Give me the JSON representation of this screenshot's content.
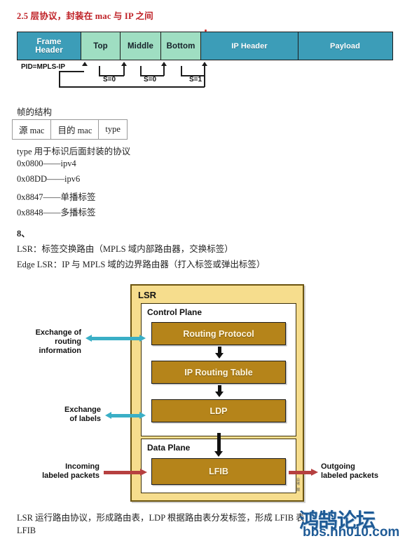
{
  "heading": "2.5 层协议，封装在 mac 与 IP 之间",
  "mpls_frame": {
    "fields": [
      {
        "label": "Frame\nHeader",
        "color": "#3c9db8",
        "kind": "blue"
      },
      {
        "label": "Top",
        "color": "#9fdec2",
        "kind": "green"
      },
      {
        "label": "Middle",
        "color": "#9fdec2",
        "kind": "green"
      },
      {
        "label": "Bottom",
        "color": "#9fdec2",
        "kind": "green"
      },
      {
        "label": "IP Header",
        "color": "#3c9db8",
        "kind": "blue"
      },
      {
        "label": "Payload",
        "color": "#3c9db8",
        "kind": "blue"
      }
    ],
    "field_labels": {
      "frame_header_line1": "Frame",
      "frame_header_line2": "Header",
      "top": "Top",
      "middle": "Middle",
      "bottom": "Bottom",
      "ip_header": "IP Header",
      "payload": "Payload"
    },
    "annotations": {
      "pid": "PID=MPLS-IP",
      "s0_a": "S=0",
      "s0_b": "S=0",
      "s1": "S=1"
    }
  },
  "section_frame_structure": {
    "caption": "帧的结构",
    "table": {
      "headers": [
        "源 mac",
        "目的 mac",
        "type"
      ]
    },
    "type_note": "type 用于标识后面封装的协议",
    "type_values": [
      "0x0800——ipv4",
      "0x08DD——ipv6",
      "0x8847——单播标签",
      "0x8848——多播标签"
    ]
  },
  "section_eight": {
    "number": "8、",
    "lsr_line": "LSR：标签交换路由（MPLS 域内部路由器，交换标签）",
    "edge_lsr_line": "Edge LSR：IP 与 MPLS 域的边界路由器（打入标签或弹出标签）"
  },
  "lsr_diagram": {
    "title": "LSR",
    "control_plane": {
      "title": "Control Plane",
      "boxes": [
        "Routing Protocol",
        "IP Routing Table",
        "LDP"
      ]
    },
    "data_plane": {
      "title": "Data Plane",
      "boxes": [
        "LFIB"
      ]
    },
    "left_labels": [
      {
        "line1": "Exchange of",
        "line2": "routing information"
      },
      {
        "line1": "Exchange",
        "line2": "of labels"
      },
      {
        "line1": "Incoming",
        "line2": "labeled packets"
      }
    ],
    "right_labels": [
      {
        "line1": "Outgoing",
        "line2": "labeled packets"
      }
    ],
    "side_note": "自拷_图",
    "colors": {
      "frame_yellow": "#f6dd8d",
      "box_gold": "#b5841a",
      "cyan_arrow": "#3aafc6",
      "red_arrow": "#b64040"
    }
  },
  "bottom_text": {
    "line1": "LSR 运行路由协议，形成路由表，LDP 根据路由表分发标签，形成 LFIB 表",
    "line2": "LFIB"
  },
  "watermark": {
    "brand": "鸿鹄论坛",
    "url": "bbs.hh010.com",
    "color": "#1f5b96"
  }
}
